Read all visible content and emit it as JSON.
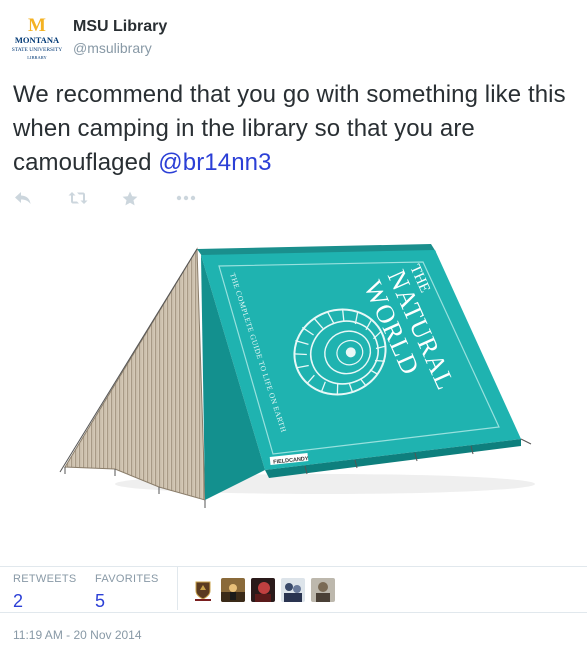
{
  "account": {
    "name": "MSU Library",
    "handle": "@msulibrary",
    "logo_letter": "M",
    "logo_line1": "MONTANA",
    "logo_line2": "STATE UNIVERSITY",
    "logo_line3": "LIBRARY"
  },
  "tweet": {
    "text": "We recommend that you go with something like this when camping in the library so that you are camouflaged ",
    "mention": "@br14nn3"
  },
  "actions": {
    "icons": [
      "reply-icon",
      "retweet-icon",
      "favorite-icon",
      "more-icon"
    ]
  },
  "media": {
    "book_title_line1": "THE",
    "book_title_line2": "NATURAL",
    "book_title_line3": "WORLD",
    "book_subtitle": "THE COMPLETE GUIDE TO LIFE ON EARTH",
    "brand": "FIELDCANDY"
  },
  "stats": {
    "retweets_label": "RETWEETS",
    "retweets_count": "2",
    "favorites_label": "FAVORITES",
    "favorites_count": "5"
  },
  "favoriters": [
    "avatar-msu-library",
    "avatar-user-2",
    "avatar-user-3",
    "avatar-user-4",
    "avatar-user-5"
  ],
  "timestamp": "11:19 AM - 20 Nov 2014",
  "colors": {
    "accent": "#2b3fd6",
    "muted": "#8899a6",
    "tent_cover": "#1fb3b0",
    "msu_gold": "#f4b223",
    "msu_blue": "#003875"
  }
}
